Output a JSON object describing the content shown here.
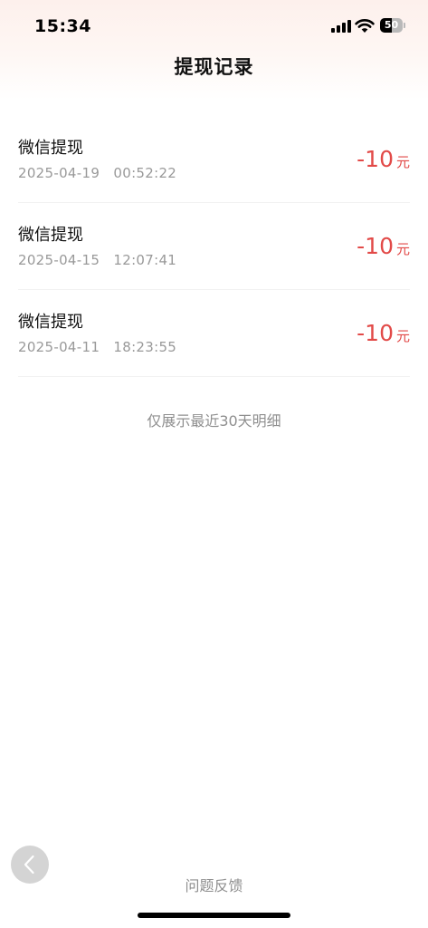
{
  "status_bar": {
    "time": "15:34",
    "battery_level": "50"
  },
  "header": {
    "title": "提现记录"
  },
  "records": [
    {
      "title": "微信提现",
      "time": "2025-04-19   00:52:22",
      "amount": "-10",
      "unit": "元"
    },
    {
      "title": "微信提现",
      "time": "2025-04-15   12:07:41",
      "amount": "-10",
      "unit": "元"
    },
    {
      "title": "微信提现",
      "time": "2025-04-11   18:23:55",
      "amount": "-10",
      "unit": "元"
    }
  ],
  "footnote": "仅展示最近30天明细",
  "feedback_label": "问题反馈",
  "colors": {
    "amount": "#e24a48",
    "secondary_text": "#999999"
  }
}
